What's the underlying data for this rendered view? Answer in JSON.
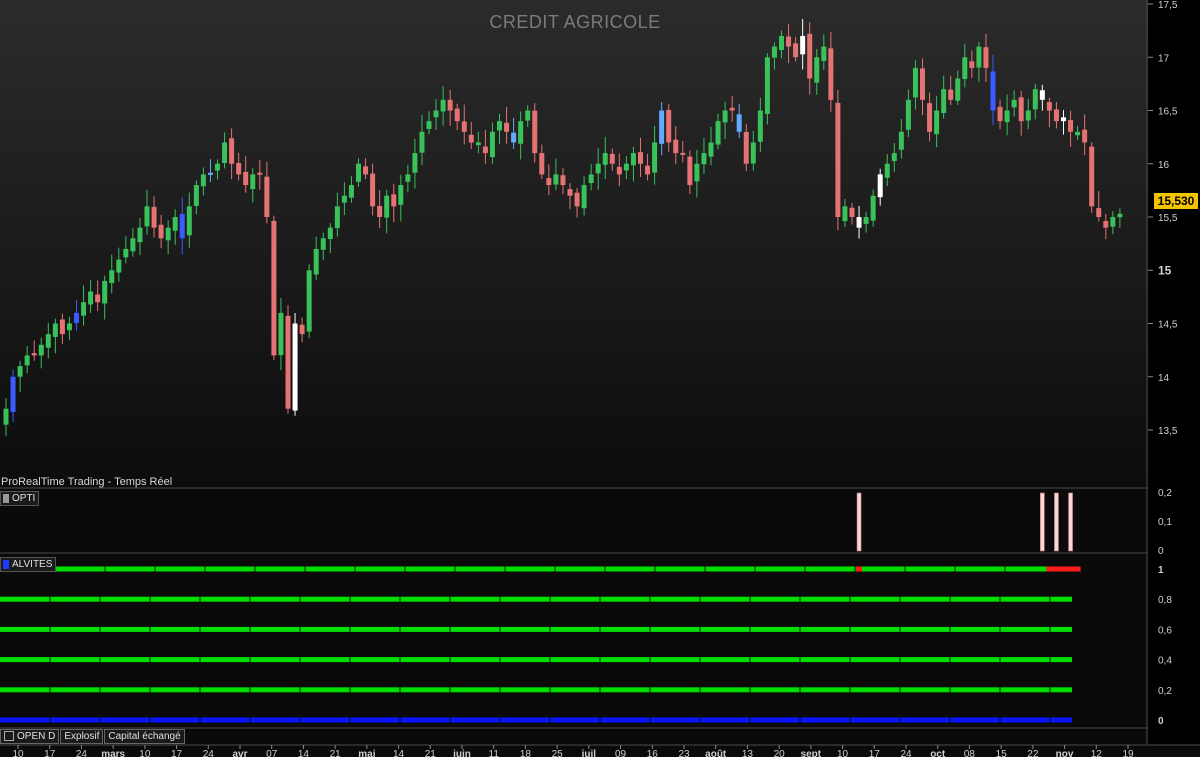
{
  "header": {
    "title": "CREDIT AGRICOLE",
    "provider_label": "ProRealTime Trading - Temps Réel",
    "last_price": "15,530"
  },
  "panels": {
    "opti_label": "OPTI",
    "alvites_label": "ALVITES"
  },
  "tabs": [
    {
      "label": "OPEN D"
    },
    {
      "label": "Explosif"
    },
    {
      "label": "Capital échangé"
    }
  ],
  "colors": {
    "up": "#39c15a",
    "down": "#e57373",
    "signal_blue": "#3a5bff",
    "signal_light_blue": "#64aaff",
    "signal_white": "#ffffff",
    "indicator_green": "#00e000",
    "indicator_red": "#ff1a1a",
    "indicator_blue": "#0a14ff",
    "opti_bar": "#f6d6d6"
  },
  "chart_data": [
    {
      "type": "candlestick",
      "title": "CREDIT AGRICOLE",
      "y_ticks": [
        "17,5",
        "17",
        "16,5",
        "16",
        "15,5",
        "15",
        "14,5",
        "14",
        "13,5"
      ],
      "ylim": [
        13.2,
        17.55
      ],
      "x_tick_labels": [
        {
          "label": "10"
        },
        {
          "label": "17"
        },
        {
          "label": "24"
        },
        {
          "label": "mars",
          "bold": true
        },
        {
          "label": "10"
        },
        {
          "label": "17"
        },
        {
          "label": "24"
        },
        {
          "label": "avr",
          "bold": true
        },
        {
          "label": "07"
        },
        {
          "label": "14"
        },
        {
          "label": "21"
        },
        {
          "label": "mai",
          "bold": true
        },
        {
          "label": "14"
        },
        {
          "label": "21"
        },
        {
          "label": "juin",
          "bold": true
        },
        {
          "label": "11"
        },
        {
          "label": "18"
        },
        {
          "label": "25"
        },
        {
          "label": "juil",
          "bold": true
        },
        {
          "label": "09"
        },
        {
          "label": "16"
        },
        {
          "label": "23"
        },
        {
          "label": "août",
          "bold": true
        },
        {
          "label": "13"
        },
        {
          "label": "20"
        },
        {
          "label": "sept",
          "bold": true
        },
        {
          "label": "10"
        },
        {
          "label": "17"
        },
        {
          "label": "24"
        },
        {
          "label": "oct",
          "bold": true
        },
        {
          "label": "08"
        },
        {
          "label": "15"
        },
        {
          "label": "22"
        },
        {
          "label": "nov",
          "bold": true
        },
        {
          "label": "12"
        },
        {
          "label": "19"
        }
      ],
      "closes": [
        13.7,
        14.0,
        14.1,
        14.2,
        14.2,
        14.3,
        14.4,
        14.5,
        14.4,
        14.5,
        14.6,
        14.7,
        14.8,
        14.7,
        14.9,
        15.0,
        15.1,
        15.2,
        15.3,
        15.4,
        15.6,
        15.4,
        15.3,
        15.4,
        15.5,
        15.3,
        15.6,
        15.8,
        15.9,
        15.9,
        16.0,
        16.2,
        16.0,
        15.9,
        15.8,
        15.9,
        15.9,
        15.5,
        14.2,
        14.6,
        13.7,
        14.5,
        14.4,
        15.0,
        15.2,
        15.3,
        15.4,
        15.6,
        15.7,
        15.8,
        16.0,
        15.9,
        15.6,
        15.5,
        15.7,
        15.6,
        15.8,
        15.9,
        16.1,
        16.3,
        16.4,
        16.5,
        16.6,
        16.5,
        16.4,
        16.3,
        16.2,
        16.2,
        16.1,
        16.3,
        16.4,
        16.3,
        16.2,
        16.4,
        16.5,
        16.1,
        15.9,
        15.8,
        15.9,
        15.8,
        15.7,
        15.6,
        15.8,
        15.9,
        16.0,
        16.1,
        16.0,
        15.9,
        16.0,
        16.1,
        16.0,
        15.9,
        16.2,
        16.5,
        16.2,
        16.1,
        16.1,
        15.8,
        16.0,
        16.1,
        16.2,
        16.4,
        16.5,
        16.5,
        16.3,
        16.0,
        16.2,
        16.5,
        17.0,
        17.1,
        17.2,
        17.1,
        17.0,
        17.2,
        16.8,
        17.0,
        17.1,
        16.6,
        15.5,
        15.6,
        15.5,
        15.4,
        15.5,
        15.7,
        15.9,
        16.0,
        16.1,
        16.3,
        16.6,
        16.9,
        16.6,
        16.3,
        16.5,
        16.7,
        16.6,
        16.8,
        17.0,
        16.9,
        17.1,
        16.9,
        16.5,
        16.4,
        16.5,
        16.6,
        16.4,
        16.5,
        16.7,
        16.6,
        16.5,
        16.4,
        16.4,
        16.3,
        16.3,
        16.2,
        15.6,
        15.5,
        15.4,
        15.5,
        15.53
      ],
      "colored_candles": [
        {
          "index": 1,
          "color": "blue"
        },
        {
          "index": 10,
          "color": "blue"
        },
        {
          "index": 25,
          "color": "blue"
        },
        {
          "index": 29,
          "color": "light_blue"
        },
        {
          "index": 41,
          "color": "white"
        },
        {
          "index": 72,
          "color": "light_blue"
        },
        {
          "index": 93,
          "color": "light_blue"
        },
        {
          "index": 104,
          "color": "light_blue"
        },
        {
          "index": 113,
          "color": "white"
        },
        {
          "index": 121,
          "color": "white"
        },
        {
          "index": 124,
          "color": "white"
        },
        {
          "index": 140,
          "color": "blue"
        },
        {
          "index": 147,
          "color": "white"
        },
        {
          "index": 150,
          "color": "white"
        }
      ]
    },
    {
      "type": "bar",
      "name": "OPTI",
      "y_ticks": [
        "0,2",
        "0,1",
        "0"
      ],
      "ylim": [
        0,
        0.2
      ],
      "points": [
        {
          "index": 121,
          "value": 0.2
        },
        {
          "index": 147,
          "value": 0.2
        },
        {
          "index": 149,
          "value": 0.2
        },
        {
          "index": 151,
          "value": 0.2
        }
      ]
    },
    {
      "type": "heatmap",
      "name": "ALVITES",
      "y_ticks": [
        "1",
        "0,8",
        "0,6",
        "0,4",
        "0,2",
        "0"
      ],
      "rows": [
        {
          "level": 1.0,
          "color": "green",
          "red_segments": [
            [
              121,
              122
            ],
            [
              148,
              153
            ]
          ]
        },
        {
          "level": 0.8,
          "color": "green",
          "red_segments": []
        },
        {
          "level": 0.6,
          "color": "green",
          "red_segments": []
        },
        {
          "level": 0.4,
          "color": "green",
          "red_segments": []
        },
        {
          "level": 0.2,
          "color": "green",
          "red_segments": []
        },
        {
          "level": 0.0,
          "color": "blue",
          "red_segments": []
        }
      ]
    }
  ]
}
